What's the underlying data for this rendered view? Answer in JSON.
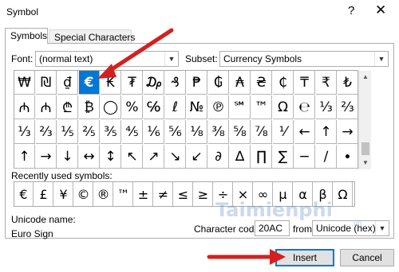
{
  "window": {
    "title": "Symbol",
    "help": "?",
    "close": "✕"
  },
  "tabs": [
    {
      "label": "Symbols"
    },
    {
      "label": "Special Characters"
    }
  ],
  "font": {
    "label": "Font:",
    "value": "(normal text)"
  },
  "subset": {
    "label": "Subset:",
    "value": "Currency Symbols"
  },
  "symbols": {
    "rows": [
      [
        "₩",
        "₪",
        "₫",
        "€",
        "₭",
        "₮",
        "₯",
        "₰",
        "₱",
        "₲",
        "₳",
        "₴",
        "₵",
        "₸",
        "₹",
        "₺"
      ],
      [
        "₼",
        "₼",
        "₾",
        "₿",
        "◯",
        "%",
        "℅",
        "ℓ",
        "№",
        "℗",
        "℠",
        "™",
        "Ω",
        "℮",
        "⅓",
        "⅔"
      ],
      [
        "⅓",
        "⅔",
        "⅕",
        "⅖",
        "⅗",
        "⅘",
        "⅙",
        "⅚",
        "⅛",
        "⅜",
        "⅝",
        "⅞",
        "⅟",
        "←",
        "↑",
        "→"
      ],
      [
        "↑",
        "→",
        "↓",
        "↔",
        "↕",
        "↖",
        "↗",
        "↘",
        "↙",
        "∂",
        "∆",
        "∏",
        "∑",
        "−",
        "∕",
        "∙"
      ]
    ],
    "selected_row": 0,
    "selected_col": 3
  },
  "recent": {
    "label": "Recently used symbols:",
    "items": [
      "€",
      "£",
      "¥",
      "©",
      "®",
      "™",
      "±",
      "≠",
      "≤",
      "≥",
      "÷",
      "×",
      "∞",
      "µ",
      "α",
      "β",
      "Ω"
    ]
  },
  "unicode": {
    "label": "Unicode name:",
    "name": "Euro Sign"
  },
  "charcode": {
    "label": "Character code:",
    "value": "20AC"
  },
  "from": {
    "label": "from:",
    "value": "Unicode (hex)"
  },
  "buttons": {
    "insert": "Insert",
    "cancel": "Cancel"
  },
  "watermark": {
    "text": "Taimienphi",
    "sub": ".vn"
  },
  "colors": {
    "accent": "#0078d7",
    "annotation": "#d42020"
  }
}
